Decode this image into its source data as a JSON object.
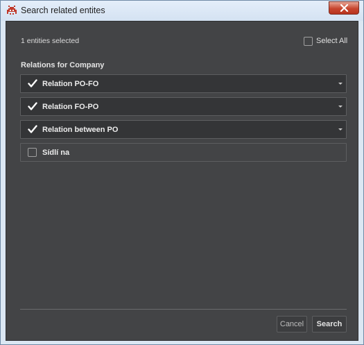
{
  "window": {
    "title": "Search related entites",
    "app_icon": "space-invader-icon",
    "close_icon": "close-icon"
  },
  "header": {
    "selected_count": "1 entities selected",
    "select_all_label": "Select All",
    "select_all_checked": false
  },
  "relations": {
    "title": "Relations for Company",
    "items": [
      {
        "label": "Relation PO-FO",
        "checked": true,
        "has_dropdown": true
      },
      {
        "label": "Relation FO-PO",
        "checked": true,
        "has_dropdown": true
      },
      {
        "label": "Relation between PO",
        "checked": true,
        "has_dropdown": true
      },
      {
        "label": "Sídlí na",
        "checked": false,
        "has_dropdown": false
      }
    ]
  },
  "footer": {
    "cancel_label": "Cancel",
    "search_label": "Search"
  },
  "colors": {
    "dialog_bg": "#434446",
    "row_bg": "#343537",
    "close_button": "#c7462f",
    "titlebar": "#dbe7f3"
  }
}
